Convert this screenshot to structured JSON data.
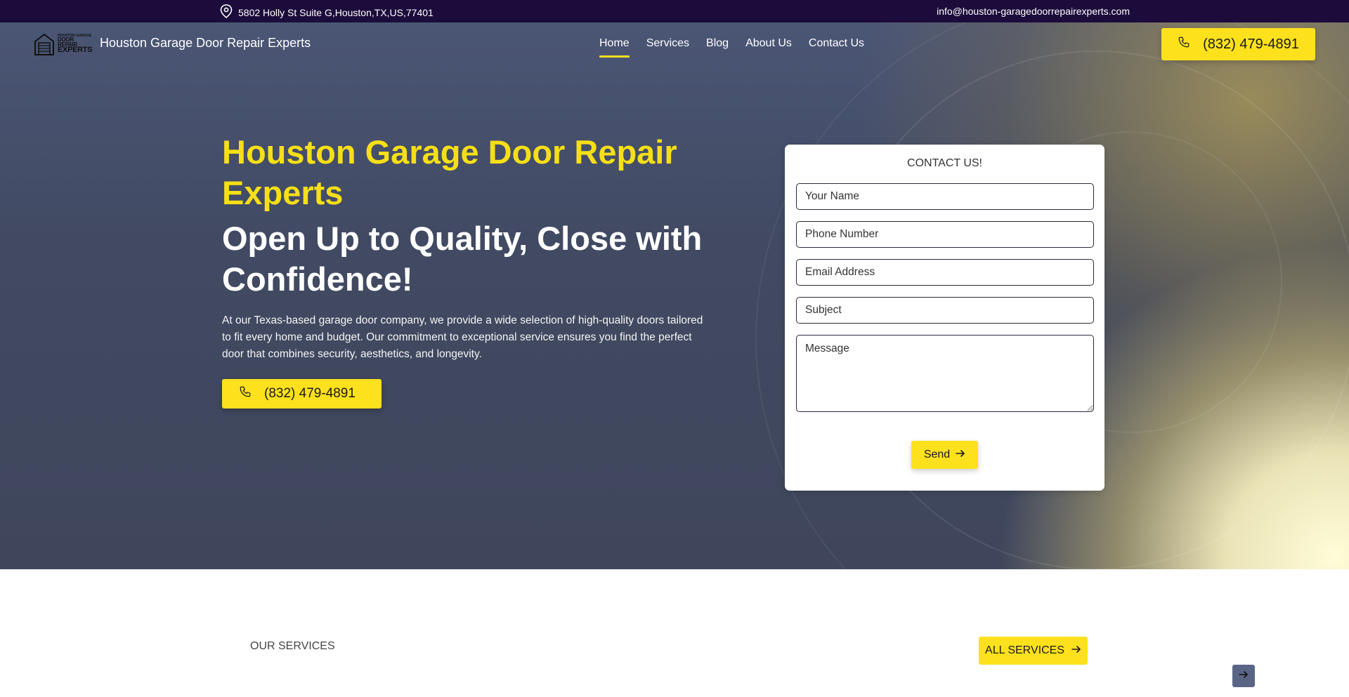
{
  "topbar": {
    "address": "5802 Holly St Suite G,Houston,TX,US,77401",
    "email": "info@houston-garagedoorrepairexperts.com",
    "address_icon": "map-pin-icon"
  },
  "header": {
    "logo_small": "HOUSTON GARAGE",
    "logo_line1": "DOOR REPAIR",
    "logo_line2": "EXPERTS",
    "brand": "Houston Garage Door Repair Experts",
    "nav": [
      {
        "label": "Home",
        "active": true
      },
      {
        "label": "Services",
        "active": false
      },
      {
        "label": "Blog",
        "active": false
      },
      {
        "label": "About Us",
        "active": false
      },
      {
        "label": "Contact Us",
        "active": false
      }
    ],
    "phone": "(832) 479-4891"
  },
  "hero": {
    "title": "Houston Garage Door Repair Experts",
    "subtitle": "Open Up to Quality, Close with Confidence!",
    "description": "At our Texas-based garage door company, we provide a wide selection of high-quality doors tailored to fit every home and budget. Our commitment to exceptional service ensures you find the perfect door that combines security, aesthetics, and longevity.",
    "phone": "(832) 479-4891"
  },
  "form": {
    "title": "CONTACT US!",
    "name_placeholder": "Your Name",
    "phone_placeholder": "Phone Number",
    "email_placeholder": "Email Address",
    "subject_placeholder": "Subject",
    "message_placeholder": "Message",
    "send_label": "Send"
  },
  "services": {
    "label": "OUR SERVICES",
    "all_label": "ALL SERVICES"
  },
  "colors": {
    "accent": "#fde11d",
    "topbar": "#1c0c3b",
    "title_yellow": "#f6df16"
  }
}
